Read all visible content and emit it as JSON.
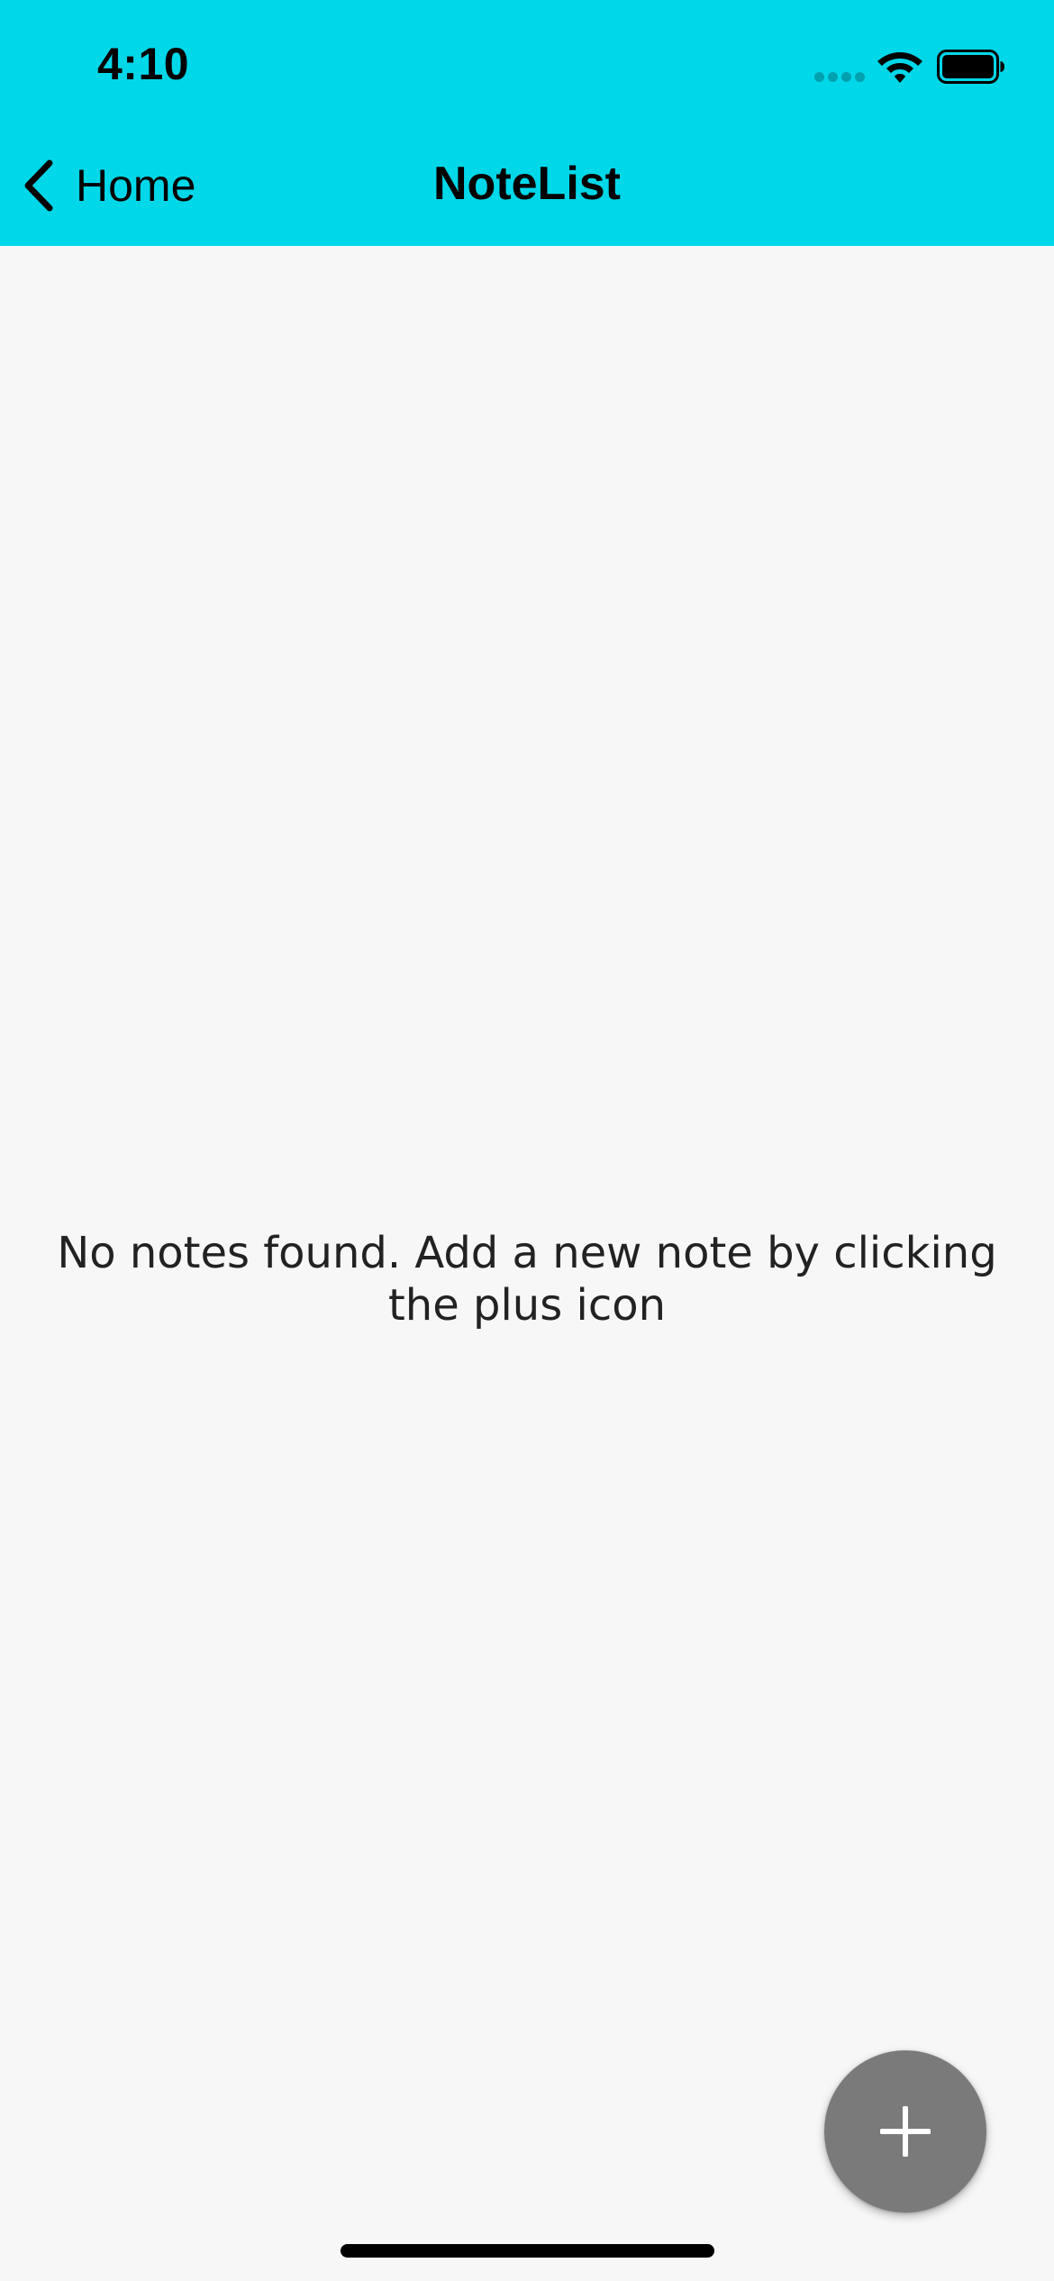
{
  "status_bar": {
    "time": "4:10",
    "icons": [
      "cellular-signal-icon",
      "wifi-icon",
      "battery-icon"
    ]
  },
  "nav_bar": {
    "back_label": "Home",
    "back_icon": "chevron-left-icon",
    "title": "NoteList",
    "background_color": "#00d7e8"
  },
  "main": {
    "empty_message": "No notes found. Add a new note by clicking the plus icon",
    "background_color": "#f7f7f7"
  },
  "fab": {
    "icon": "plus-icon",
    "color": "#7a7a7a"
  }
}
